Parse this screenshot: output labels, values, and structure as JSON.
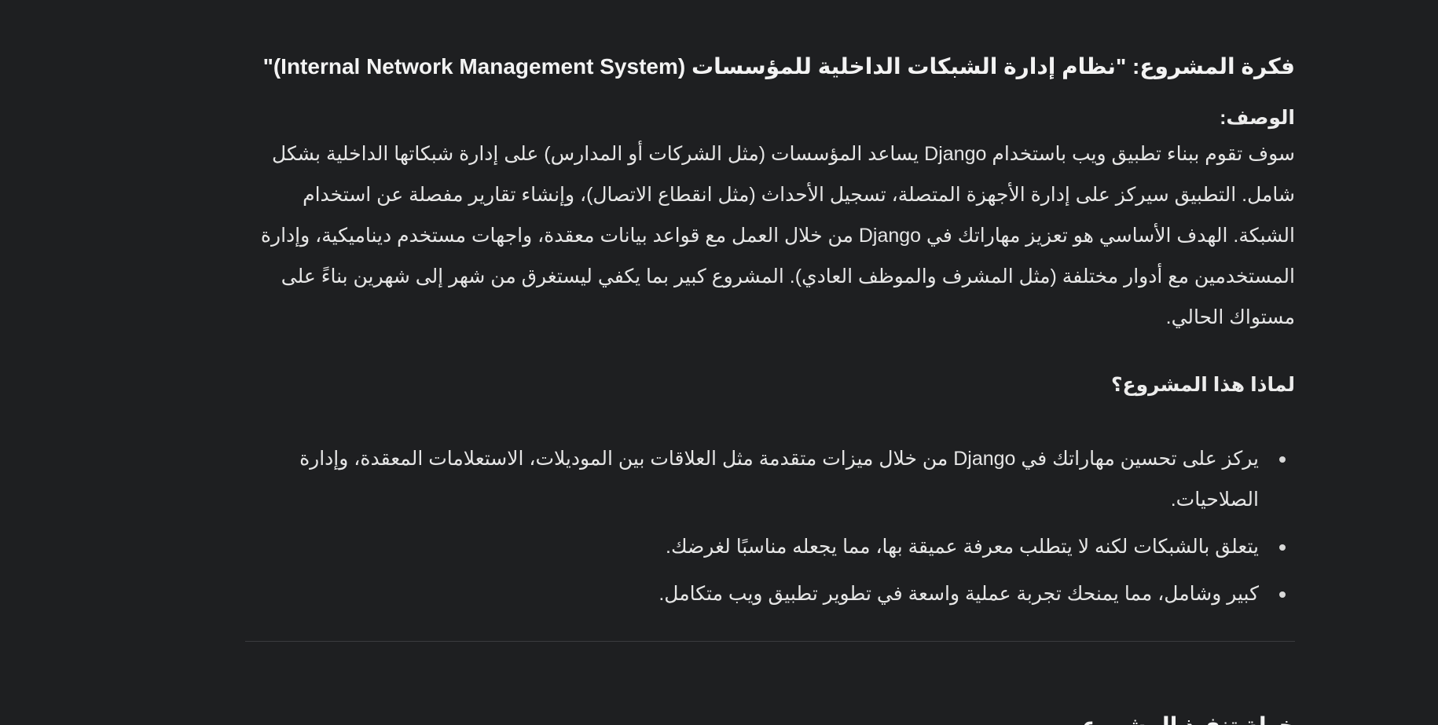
{
  "doc": {
    "title": "فكرة المشروع: \"نظام إدارة الشبكات الداخلية للمؤسسات (Internal Network Management System)\"",
    "description_label": "الوصف:",
    "description": "سوف تقوم ببناء تطبيق ويب باستخدام Django يساعد المؤسسات (مثل الشركات أو المدارس) على إدارة شبكاتها الداخلية بشكل شامل. التطبيق سيركز على إدارة الأجهزة المتصلة، تسجيل الأحداث (مثل انقطاع الاتصال)، وإنشاء تقارير مفصلة عن استخدام الشبكة. الهدف الأساسي هو تعزيز مهاراتك في Django من خلال العمل مع قواعد بيانات معقدة، واجهات مستخدم ديناميكية، وإدارة المستخدمين مع أدوار مختلفة (مثل المشرف والموظف العادي). المشروع كبير بما يكفي ليستغرق من شهر إلى شهرين بناءً على مستواك الحالي.",
    "why_heading": "لماذا هذا المشروع؟",
    "why_items": [
      "يركز على تحسين مهاراتك في Django من خلال ميزات متقدمة مثل العلاقات بين الموديلات، الاستعلامات المعقدة، وإدارة الصلاحيات.",
      "يتعلق بالشبكات لكنه لا يتطلب معرفة عميقة بها، مما يجعله مناسبًا لغرضك.",
      "كبير وشامل، مما يمنحك تجربة عملية واسعة في تطوير تطبيق ويب متكامل."
    ],
    "next_heading": "خطة تنفيذ المشروع"
  }
}
